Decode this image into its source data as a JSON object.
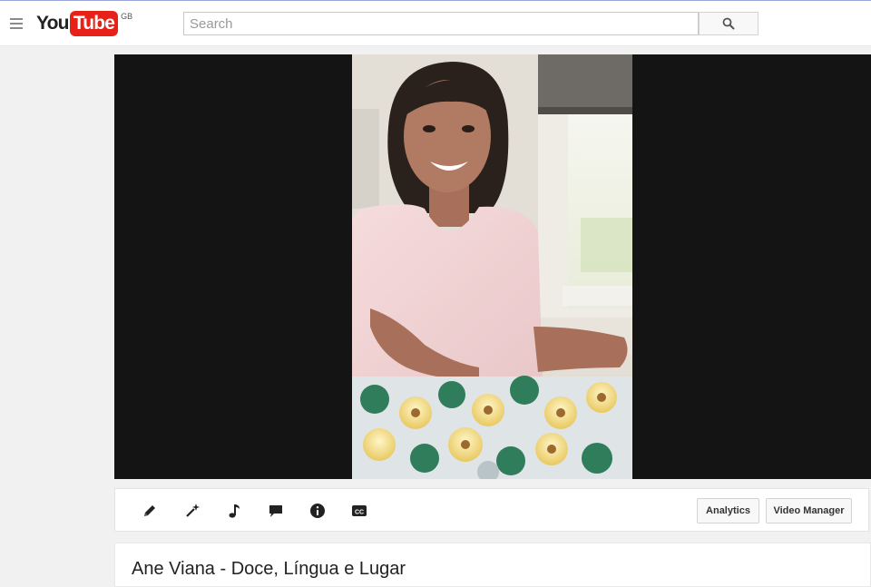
{
  "header": {
    "logo_you": "You",
    "logo_tube": "Tube",
    "region": "GB",
    "search_placeholder": "Search"
  },
  "player": {
    "frame_description": "woman smiling with hands outstretched behind a tray of wrapped sweets"
  },
  "toolbar": {
    "icons": [
      "pencil-icon",
      "magic-wand-icon",
      "music-note-icon",
      "comment-icon",
      "info-icon",
      "captions-icon"
    ],
    "analytics_label": "Analytics",
    "video_manager_label": "Video Manager"
  },
  "video": {
    "title": "Ane Viana - Doce, Língua e Lugar"
  },
  "colors": {
    "brand_red": "#e62117",
    "page_bg": "#f1f1f1",
    "player_bg": "#141414"
  }
}
